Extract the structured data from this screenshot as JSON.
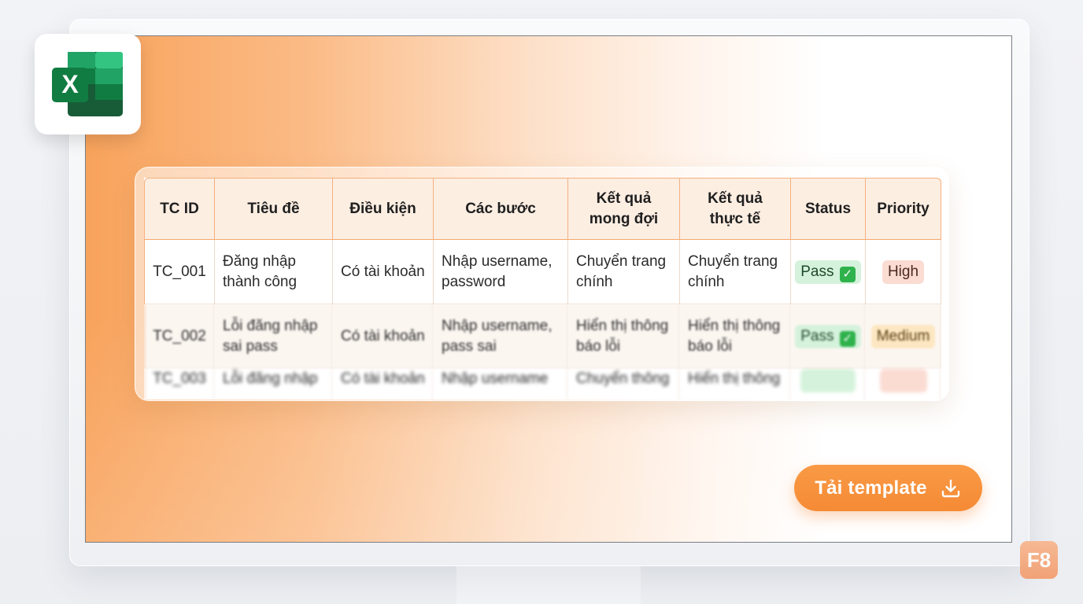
{
  "table": {
    "headers": [
      "TC ID",
      "Tiêu đề",
      "Điều kiện",
      "Các bước",
      "Kết quả mong đợi",
      "Kết quả thực tế",
      "Status",
      "Priority"
    ],
    "rows": [
      {
        "id": "TC_001",
        "title": "Đăng nhập thành công",
        "condition": "Có tài khoản",
        "steps": "Nhập username, password",
        "expected": "Chuyển trang chính",
        "actual": "Chuyển trang chính",
        "status": "Pass",
        "priority": "High"
      },
      {
        "id": "TC_002",
        "title": "Lỗi đăng nhập sai pass",
        "condition": "Có tài khoản",
        "steps": "Nhập username, pass sai",
        "expected": "Hiển thị thông báo lỗi",
        "actual": "Hiển thị thông báo lỗi",
        "status": "Pass",
        "priority": "Medium"
      },
      {
        "id": "TC_003",
        "title": "Lỗi đăng nhập",
        "condition": "Có tài khoản",
        "steps": "Nhập username",
        "expected": "Chuyển thông",
        "actual": "Hiển thị thông",
        "status": "",
        "priority": ""
      }
    ]
  },
  "download_button": {
    "label": "Tải template"
  },
  "brand": {
    "logo_text": "F8",
    "excel_letter": "X"
  },
  "colors": {
    "accent": "#F58A35",
    "pass_bg": "#D5F2DC",
    "high_bg": "#FBDCD3",
    "medium_bg": "#FDE7C2",
    "excel_green": "#107C41"
  },
  "icons": {
    "excel": "excel-icon",
    "download": "download-icon",
    "check": "check-icon"
  }
}
